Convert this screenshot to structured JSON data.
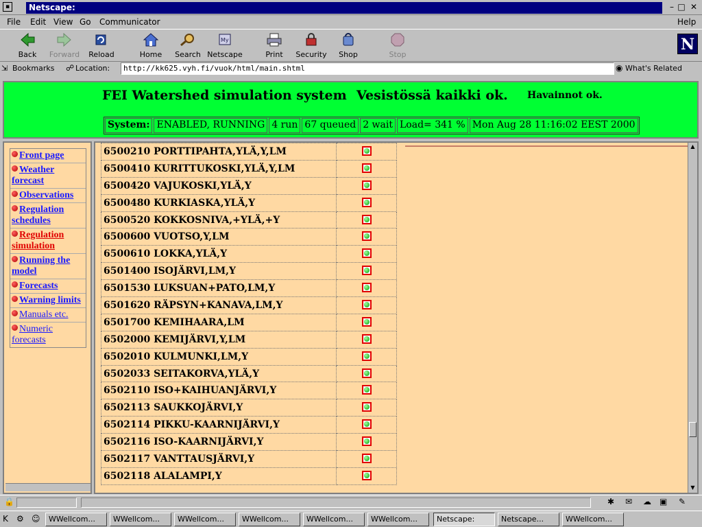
{
  "window": {
    "title": "Netscape:"
  },
  "menubar": {
    "items": [
      "File",
      "Edit",
      "View",
      "Go",
      "Communicator"
    ],
    "help": "Help"
  },
  "navbar": {
    "buttons": [
      {
        "label": "Back",
        "icon": "back-arrow-icon",
        "enabled": true
      },
      {
        "label": "Forward",
        "icon": "forward-arrow-icon",
        "enabled": false
      },
      {
        "label": "Reload",
        "icon": "reload-icon",
        "enabled": true
      },
      {
        "label": "Home",
        "icon": "home-icon",
        "enabled": true
      },
      {
        "label": "Search",
        "icon": "search-icon",
        "enabled": true
      },
      {
        "label": "Netscape",
        "icon": "netscape-icon",
        "enabled": true
      },
      {
        "label": "Print",
        "icon": "print-icon",
        "enabled": true
      },
      {
        "label": "Security",
        "icon": "security-lock-icon",
        "enabled": true
      },
      {
        "label": "Shop",
        "icon": "shop-icon",
        "enabled": true
      },
      {
        "label": "Stop",
        "icon": "stop-icon",
        "enabled": false
      }
    ],
    "logo": "N"
  },
  "location": {
    "bookmarks": "Bookmarks",
    "label": "Location:",
    "url": "http://kk625.vyh.fi/vuok/html/main.shtml",
    "related": "What's Related"
  },
  "header": {
    "title": "FEI Watershed simulation system",
    "status": "Vesistössä kaikki ok.",
    "observations": "Havainnot ok.",
    "system": {
      "label": "System:",
      "state": "ENABLED, RUNNING",
      "run": "4 run",
      "queued": "67 queued",
      "wait": "2 wait",
      "load": "Load= 341 %",
      "time": "Mon Aug 28 11:16:02 EEST 2000"
    }
  },
  "leftnav": {
    "items": [
      {
        "label": "Front page",
        "active": false,
        "light": false
      },
      {
        "label": "Weather forecast",
        "active": false,
        "light": false
      },
      {
        "label": "Observations",
        "active": false,
        "light": false
      },
      {
        "label": "Regulation schedules",
        "active": false,
        "light": false
      },
      {
        "label": "Regulation simulation",
        "active": true,
        "light": false
      },
      {
        "label": "Running the model",
        "active": false,
        "light": false
      },
      {
        "label": "Forecasts",
        "active": false,
        "light": false
      },
      {
        "label": "Warning limits",
        "active": false,
        "light": false
      },
      {
        "label": "Manuals etc.",
        "active": false,
        "light": true
      },
      {
        "label": "Numeric forecasts",
        "active": false,
        "light": true
      }
    ]
  },
  "stations": [
    {
      "name": "6500210 PORTTIPAHTA,YLÄ,Y,LM",
      "status": "ok"
    },
    {
      "name": "6500410 KURITTUKOSKI,YLÄ,Y,LM",
      "status": "ok"
    },
    {
      "name": "6500420 VAJUKOSKI,YLÄ,Y",
      "status": "ok"
    },
    {
      "name": "6500480 KURKIASKA,YLÄ,Y",
      "status": "ok"
    },
    {
      "name": "6500520 KOKKOSNIVA,+YLÄ,+Y",
      "status": "ok"
    },
    {
      "name": "6500600 VUOTSO,Y,LM",
      "status": "ok"
    },
    {
      "name": "6500610 LOKKA,YLÄ,Y",
      "status": "ok"
    },
    {
      "name": "6501400 ISOJÄRVI,LM,Y",
      "status": "ok"
    },
    {
      "name": "6501530 LUKSUAN+PATO,LM,Y",
      "status": "ok"
    },
    {
      "name": "6501620 RÄPSYN+KANAVA,LM,Y",
      "status": "ok"
    },
    {
      "name": "6501700 KEMIHAARA,LM",
      "status": "ok"
    },
    {
      "name": "6502000 KEMIJÄRVI,Y,LM",
      "status": "ok"
    },
    {
      "name": "6502010 KULMUNKI,LM,Y",
      "status": "ok"
    },
    {
      "name": "6502033 SEITAKORVA,YLÄ,Y",
      "status": "ok"
    },
    {
      "name": "6502110 ISO+KAIHUANJÄRVI,Y",
      "status": "ok"
    },
    {
      "name": "6502113 SAUKKOJÄRVI,Y",
      "status": "ok"
    },
    {
      "name": "6502114 PIKKU-KAARNIJÄRVI,Y",
      "status": "ok"
    },
    {
      "name": "6502116 ISO-KAARNIJÄRVI,Y",
      "status": "ok"
    },
    {
      "name": "6502117 VANTTAUSJÄRVI,Y",
      "status": "ok"
    },
    {
      "name": "6502118 ALALAMPI,Y",
      "status": "ok"
    }
  ],
  "taskbar": {
    "items": [
      {
        "label": "WWellcom...",
        "active": false
      },
      {
        "label": "WWellcom...",
        "active": false
      },
      {
        "label": "WWellcom...",
        "active": false
      },
      {
        "label": "WWellcom...",
        "active": false
      },
      {
        "label": "WWellcom...",
        "active": false
      },
      {
        "label": "WWellcom...",
        "active": false
      },
      {
        "label": "Netscape:",
        "active": true
      },
      {
        "label": "Netscape...",
        "active": false
      },
      {
        "label": "WWellcom...",
        "active": false
      }
    ]
  },
  "colors": {
    "header_bg": "#00ff33",
    "content_bg": "#ffd9a3",
    "link": "#1a1aff",
    "active_link": "#e00000",
    "title_bar": "#000080"
  }
}
